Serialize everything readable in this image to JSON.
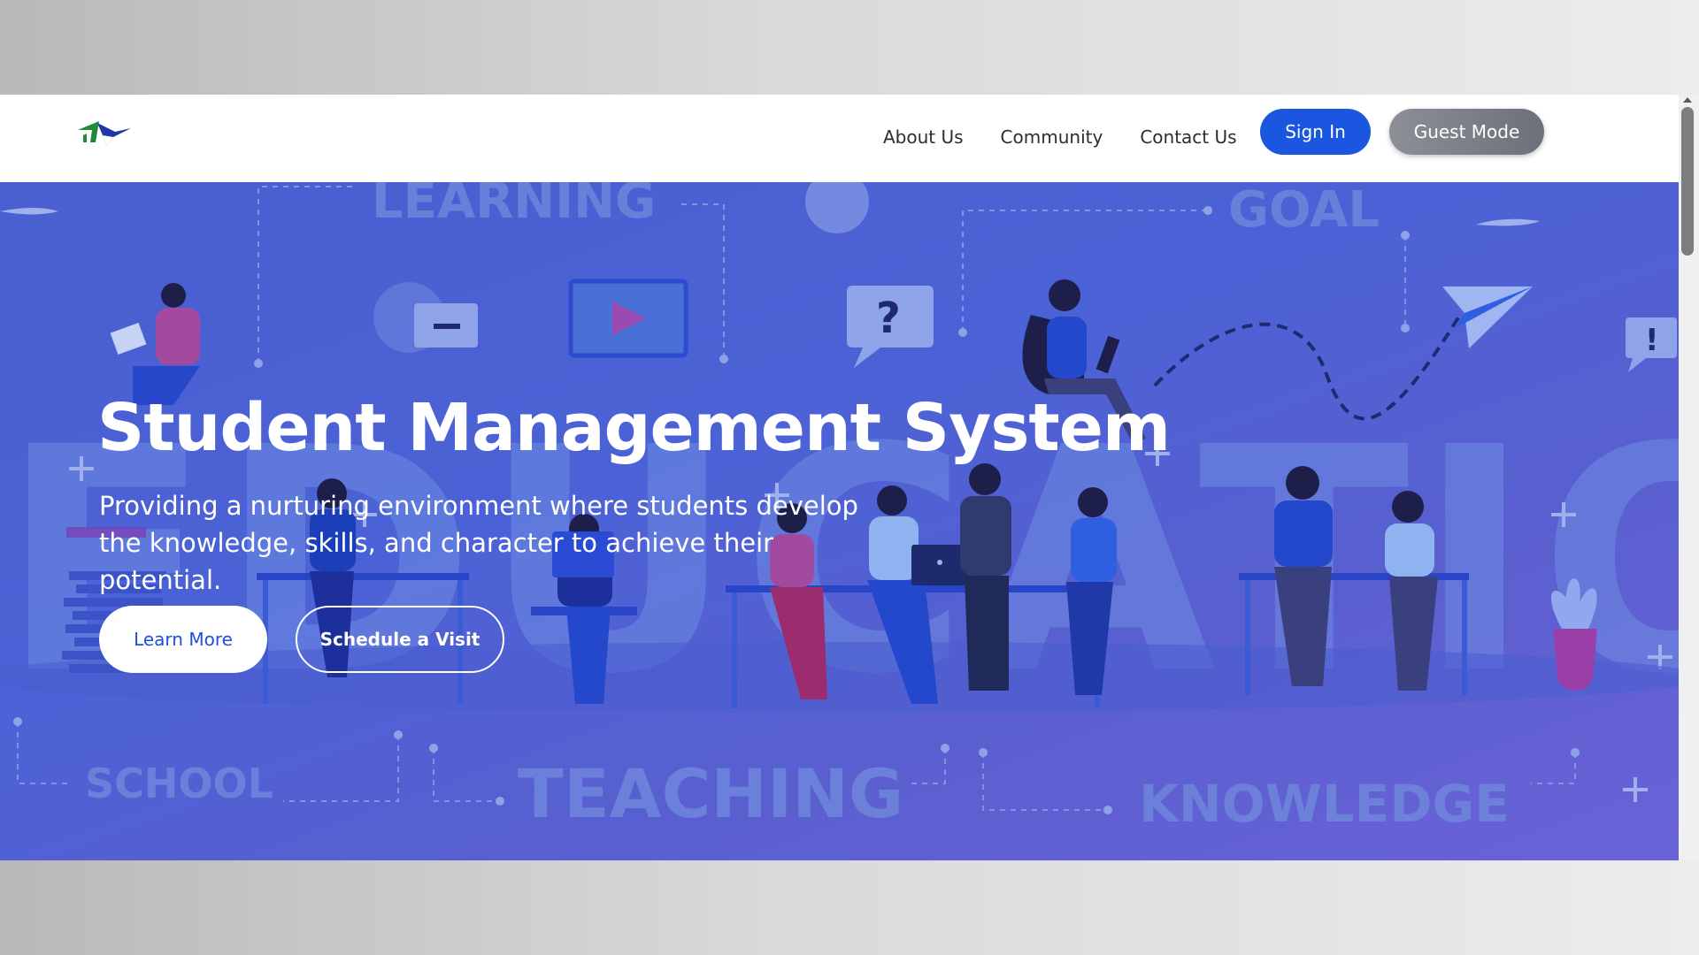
{
  "nav": {
    "links": [
      "About Us",
      "Community",
      "Contact Us"
    ],
    "sign_in": "Sign In",
    "guest_mode": "Guest Mode"
  },
  "hero": {
    "title": "Student Management System",
    "subtitle": "Providing a nurturing environment where students develop the knowledge, skills, and character to achieve their potential.",
    "learn_more": "Learn More",
    "schedule_visit": "Schedule a Visit",
    "background_words": [
      "LEARNING",
      "GOAL",
      "EDUCATION",
      "SCHOOL",
      "TEACHING",
      "KNOWLEDGE"
    ]
  },
  "colors": {
    "primary_button": "#1a56e0",
    "guest_button": "#7b7f87",
    "hero_gradient_start": "#4a5fd0",
    "hero_gradient_end": "#6a63d8",
    "logo_green": "#1f8a3a",
    "logo_blue": "#2336a8"
  },
  "icons": [
    "logo-icon",
    "play-icon",
    "question-bubble-icon",
    "exclamation-bubble-icon",
    "paper-plane-icon",
    "plus-icon"
  ]
}
